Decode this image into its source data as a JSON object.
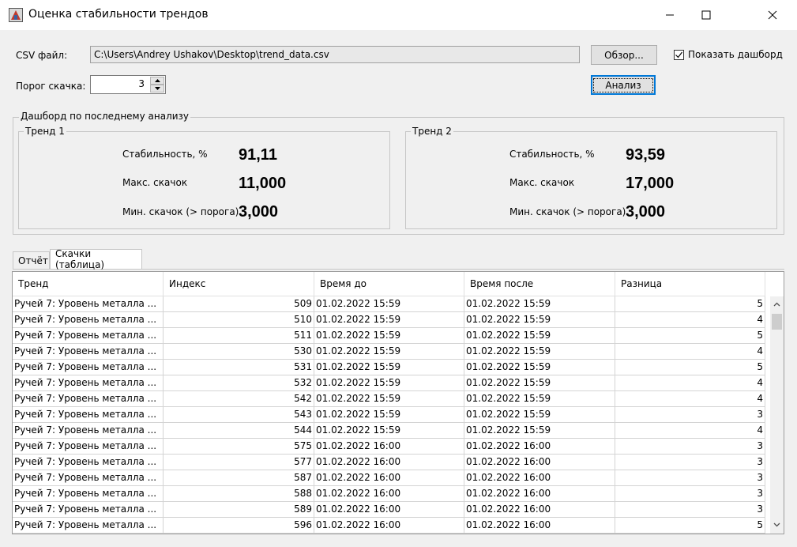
{
  "window": {
    "title": "Оценка стабильности трендов"
  },
  "form": {
    "csv_label": "CSV файл:",
    "csv_path": "C:\\Users\\Andrey Ushakov\\Desktop\\trend_data.csv",
    "browse_label": "Обзор...",
    "show_dashboard_label": "Показать дашборд",
    "show_dashboard_checked": true,
    "threshold_label": "Порог скачка:",
    "threshold_value": "3",
    "analyze_label": "Анализ"
  },
  "dashboard": {
    "title": "Дашборд по последнему анализу",
    "trends": [
      {
        "title": "Тренд 1",
        "stability_label": "Стабильность, %",
        "stability_value": "91,11",
        "max_label": "Макс. скачок",
        "max_value": "11,000",
        "min_label": "Мин. скачок (> порога)",
        "min_value": "3,000"
      },
      {
        "title": "Тренд 2",
        "stability_label": "Стабильность, %",
        "stability_value": "93,59",
        "max_label": "Макс. скачок",
        "max_value": "17,000",
        "min_label": "Мин. скачок (> порога)",
        "min_value": "3,000"
      }
    ]
  },
  "tabs": [
    {
      "label": "Отчёт",
      "active": false
    },
    {
      "label": "Скачки (таблица)",
      "active": true
    }
  ],
  "table": {
    "columns": [
      "Тренд",
      "Индекс",
      "Время до",
      "Время после",
      "Разница"
    ],
    "rows": [
      [
        "Ручей 7: Уровень металла ...",
        "509",
        "01.02.2022 15:59",
        "01.02.2022 15:59",
        "5"
      ],
      [
        "Ручей 7: Уровень металла ...",
        "510",
        "01.02.2022 15:59",
        "01.02.2022 15:59",
        "4"
      ],
      [
        "Ручей 7: Уровень металла ...",
        "511",
        "01.02.2022 15:59",
        "01.02.2022 15:59",
        "5"
      ],
      [
        "Ручей 7: Уровень металла ...",
        "530",
        "01.02.2022 15:59",
        "01.02.2022 15:59",
        "4"
      ],
      [
        "Ручей 7: Уровень металла ...",
        "531",
        "01.02.2022 15:59",
        "01.02.2022 15:59",
        "5"
      ],
      [
        "Ручей 7: Уровень металла ...",
        "532",
        "01.02.2022 15:59",
        "01.02.2022 15:59",
        "4"
      ],
      [
        "Ручей 7: Уровень металла ...",
        "542",
        "01.02.2022 15:59",
        "01.02.2022 15:59",
        "4"
      ],
      [
        "Ручей 7: Уровень металла ...",
        "543",
        "01.02.2022 15:59",
        "01.02.2022 15:59",
        "3"
      ],
      [
        "Ручей 7: Уровень металла ...",
        "544",
        "01.02.2022 15:59",
        "01.02.2022 15:59",
        "4"
      ],
      [
        "Ручей 7: Уровень металла ...",
        "575",
        "01.02.2022 16:00",
        "01.02.2022 16:00",
        "3"
      ],
      [
        "Ручей 7: Уровень металла ...",
        "577",
        "01.02.2022 16:00",
        "01.02.2022 16:00",
        "3"
      ],
      [
        "Ручей 7: Уровень металла ...",
        "587",
        "01.02.2022 16:00",
        "01.02.2022 16:00",
        "3"
      ],
      [
        "Ручей 7: Уровень металла ...",
        "588",
        "01.02.2022 16:00",
        "01.02.2022 16:00",
        "3"
      ],
      [
        "Ручей 7: Уровень металла ...",
        "589",
        "01.02.2022 16:00",
        "01.02.2022 16:00",
        "3"
      ],
      [
        "Ручей 7: Уровень металла ...",
        "596",
        "01.02.2022 16:00",
        "01.02.2022 16:00",
        "5"
      ]
    ]
  }
}
